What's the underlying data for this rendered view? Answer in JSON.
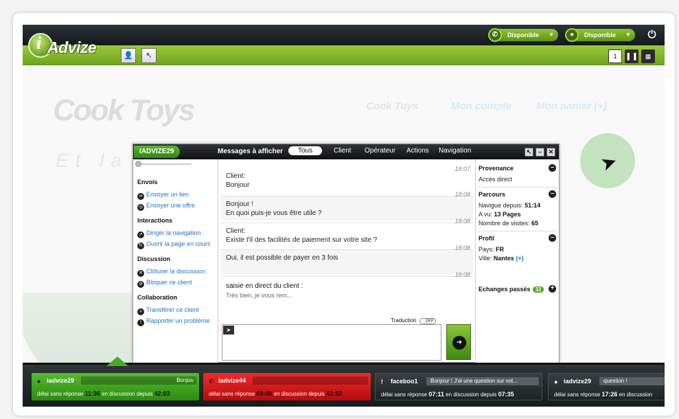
{
  "app": {
    "logo_text": "Advize",
    "logo_i": "i",
    "status": [
      {
        "label": "Disponible",
        "icon": "phone-icon"
      },
      {
        "label": "Disponible",
        "icon": "chat-bubble-icon"
      }
    ],
    "layout_buttons": [
      "1",
      "",
      ""
    ]
  },
  "website": {
    "logo": "Cook Toys",
    "nav": [
      "Cook Toys",
      "Mon compte",
      "Mon panier (+)"
    ],
    "tagline": "Et la"
  },
  "chat": {
    "agent": "IADVIZE29",
    "messages_title": "Messages à afficher",
    "tabs": [
      "Tous",
      "Client",
      "Opérateur",
      "Actions",
      "Navigation"
    ],
    "sections": [
      {
        "title": "Envois",
        "links": [
          "Envoyer un lien",
          "Envoyer une offre"
        ]
      },
      {
        "title": "Interactions",
        "links": [
          "Diriger la navigation",
          "Ouvrir la page en cours"
        ]
      },
      {
        "title": "Discussion",
        "links": [
          "Clôturer la discussion",
          "Bloquer ce client"
        ]
      },
      {
        "title": "Collaboration",
        "links": [
          "Transférer ce client",
          "Rapporter un problème"
        ]
      }
    ],
    "messages": [
      {
        "time": "18:07",
        "who": "Client:",
        "text": "Bonjour"
      },
      {
        "time": "18:08",
        "who": "",
        "text": "Bonjour !",
        "text2": "En quoi puis-je vous être utile ?"
      },
      {
        "time": "18:08",
        "who": "Client:",
        "text": "Existe t'il des facilités de paiement sur votre site ?"
      },
      {
        "time": "18:08",
        "who": "",
        "text": "Oui, il est possible de payer en 3 fois"
      },
      {
        "time": "18:08",
        "who": "",
        "text": "saisie en direct du client :",
        "text2": "Très bien, je vous rem..."
      }
    ],
    "translation_label": "Traduction",
    "translation_state": "OFF",
    "input_value": "",
    "info": {
      "provenance_title": "Provenance",
      "provenance_value": "Accès direct",
      "parcours_title": "Parcours",
      "navigue_label": "Navigue depuis:",
      "navigue_value": "51:14",
      "avu_label": "A vu:",
      "avu_value": "13 Pages",
      "visites_label": "Nombre de visites:",
      "visites_value": "65",
      "profil_title": "Profil",
      "pays_label": "Pays:",
      "pays_value": "FR",
      "ville_label": "Ville:",
      "ville_value": "Nantes",
      "ville_more": "(+)",
      "echanges_label": "Echanges passés",
      "echanges_count": "32"
    }
  },
  "tray": [
    {
      "name": "iadvize29",
      "msg": "Bonjou",
      "wait_label": "délai sans réponse",
      "wait": "11:36",
      "since_label": "en discussion depuis",
      "since": "42:03",
      "color": "green"
    },
    {
      "name": "iadvize44",
      "msg": "",
      "wait_label": "délai sans réponse",
      "wait": "09:40",
      "since_label": "en discussion depuis",
      "since": "41:53",
      "color": "red"
    },
    {
      "name": "faceboo1",
      "msg": "Bonjour ! J'ai une question sur vot...",
      "wait_label": "délai sans réponse",
      "wait": "07:11",
      "since_label": "en discussion depuis",
      "since": "07:35",
      "color": "dark"
    },
    {
      "name": "iadvize29",
      "msg": "question !",
      "wait_label": "délai sans réponse",
      "wait": "17:26",
      "since_label": "en discussion",
      "since": "",
      "color": "dark"
    }
  ]
}
